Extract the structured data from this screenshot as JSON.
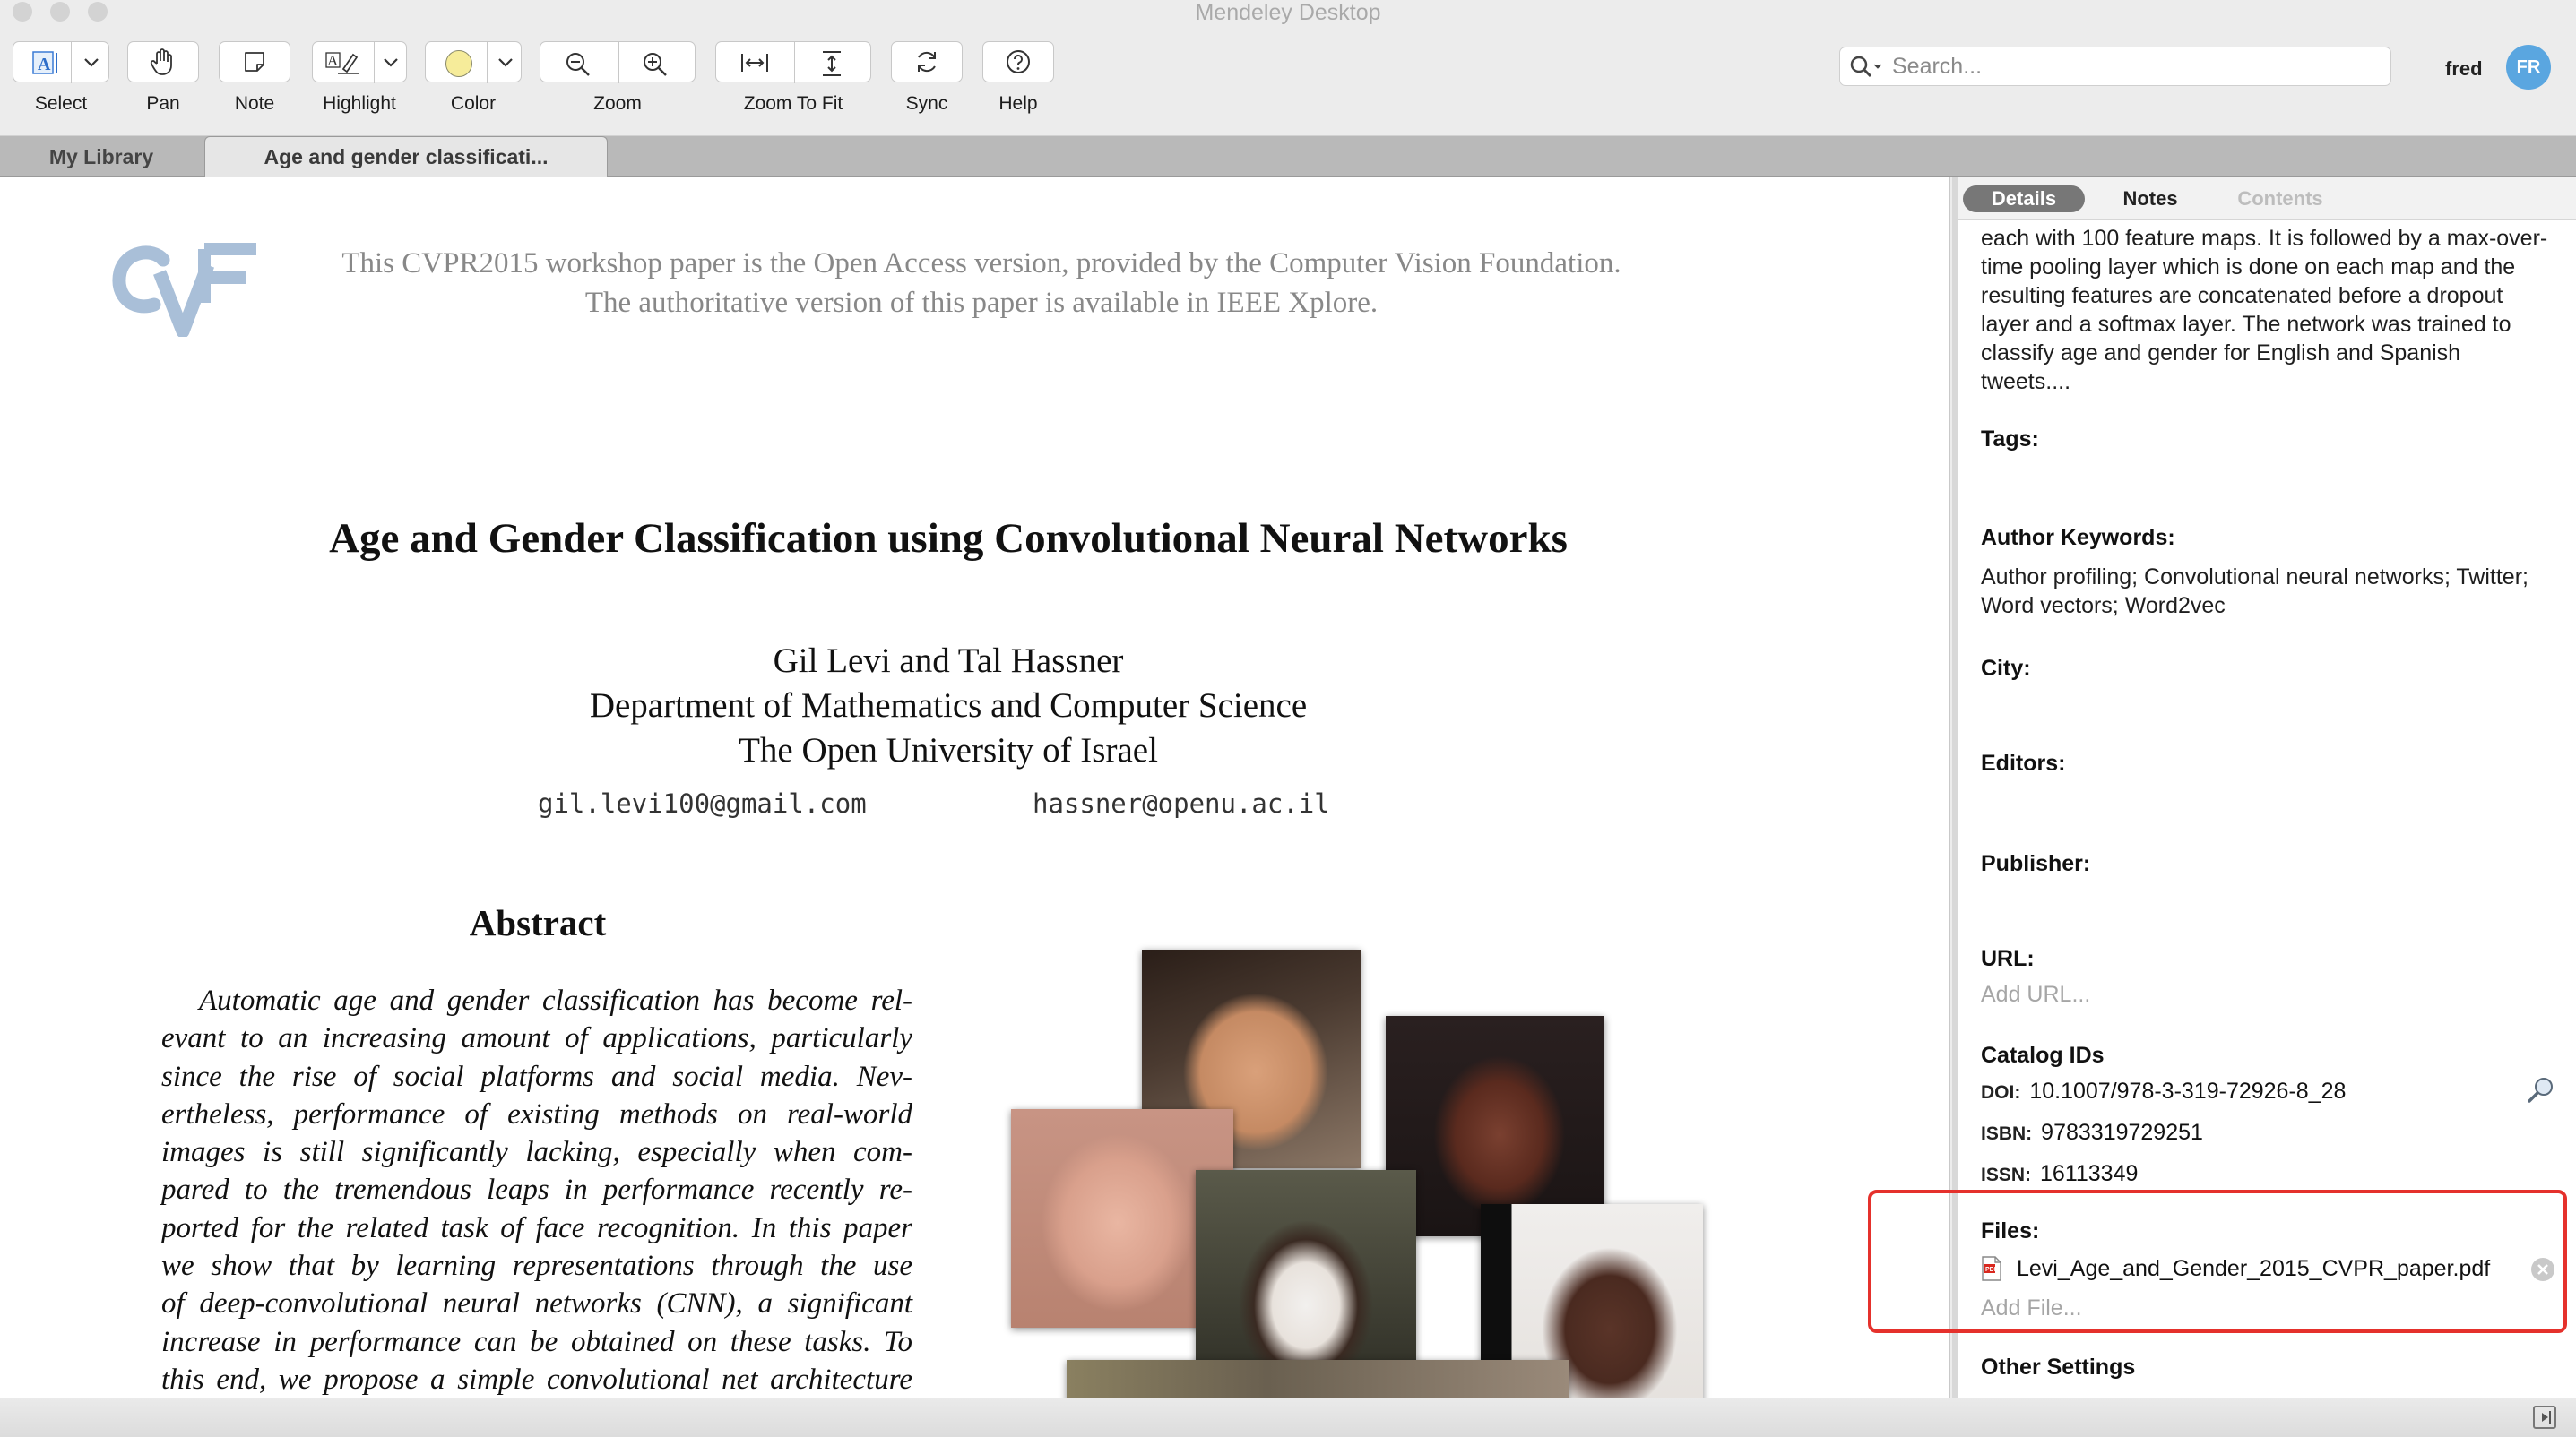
{
  "window": {
    "title": "Mendeley Desktop"
  },
  "toolbar": {
    "select": "Select",
    "pan": "Pan",
    "note": "Note",
    "highlight": "Highlight",
    "color": "Color",
    "zoom": "Zoom",
    "zoom_to_fit": "Zoom To Fit",
    "sync": "Sync",
    "help": "Help",
    "highlight_color": "#f6ec9a"
  },
  "search": {
    "placeholder": "Search..."
  },
  "user": {
    "name": "fred",
    "initials": "FR",
    "avatar_color": "#5aa6e0"
  },
  "tabs": {
    "library": "My Library",
    "document": "Age and gender classificati..."
  },
  "pdf": {
    "notice_line1": "This CVPR2015 workshop paper is the Open Access version, provided by the Computer Vision Foundation.",
    "notice_line2": "The authoritative version of this paper is available in IEEE Xplore.",
    "title": "Age and Gender Classification using Convolutional Neural Networks",
    "authors": "Gil Levi and Tal Hassner",
    "department": "Department of Mathematics and Computer Science",
    "university": "The Open University of Israel",
    "email1": "gil.levi100@gmail.com",
    "email2": "hassner@openu.ac.il",
    "abstract_heading": "Abstract",
    "abstract_lines": [
      "Automatic age and gender classification has become rel-",
      "evant to an increasing amount of applications, particularly",
      "since the rise of social platforms and social media.  Nev-",
      "ertheless, performance of existing methods on real-world",
      "images is still significantly lacking, especially when com-",
      "pared to the tremendous leaps in performance recently re-",
      "ported for the related task of face recognition. In this paper",
      "we show that by learning representations through the use",
      "of deep-convolutional neural networks (CNN), a significant",
      "increase in performance can be obtained on these tasks. To",
      "this end, we propose a simple convolutional net architecture"
    ]
  },
  "details": {
    "tabs": {
      "details": "Details",
      "notes": "Notes",
      "contents": "Contents"
    },
    "abstract_tail": "each with 100 feature maps. It is followed by a max-over-time pooling layer which is done on each map and the resulting features are concatenated before a dropout layer and a softmax layer. The network was trained to classify age and gender for English and Spanish tweets....",
    "tags_label": "Tags:",
    "author_keywords_label": "Author Keywords:",
    "author_keywords": "Author profiling; Convolutional neural networks; Twitter; Word vectors; Word2vec",
    "city_label": "City:",
    "editors_label": "Editors:",
    "publisher_label": "Publisher:",
    "url_label": "URL:",
    "url_placeholder": "Add URL...",
    "catalog_label": "Catalog IDs",
    "doi_key": "DOI:",
    "doi": "10.1007/978-3-319-72926-8_28",
    "isbn_key": "ISBN:",
    "isbn": "9783319729251",
    "issn_key": "ISSN:",
    "issn": "16113349",
    "files_label": "Files:",
    "file_name": "Levi_Age_and_Gender_2015_CVPR_paper.pdf",
    "add_file": "Add File...",
    "other_settings": "Other Settings"
  }
}
